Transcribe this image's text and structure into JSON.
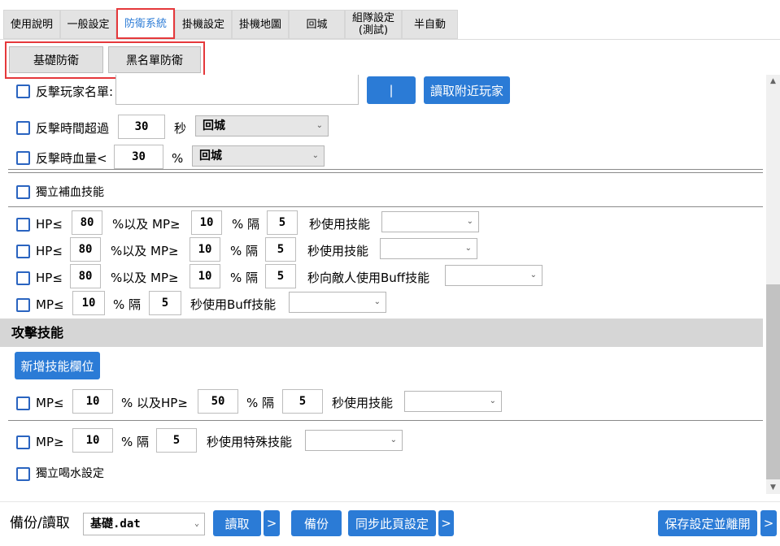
{
  "tabs": [
    {
      "label": "使用說明"
    },
    {
      "label": "一般設定"
    },
    {
      "label": "防衛系統"
    },
    {
      "label": "掛機設定"
    },
    {
      "label": "掛機地圖"
    },
    {
      "label": "回城"
    },
    {
      "label": "組隊設定\n(測試)"
    },
    {
      "label": "半自動"
    }
  ],
  "subtabs": [
    "基礎防衛",
    "黑名單防衛"
  ],
  "counter": {
    "list_label": "反擊玩家名單:",
    "pipe_button": "|",
    "read_nearby_button": "讀取附近玩家",
    "timeout_label": "反擊時間超過",
    "timeout_value": "30",
    "timeout_unit": "秒",
    "timeout_action": "回城",
    "hp_label": "反擊時血量<",
    "hp_value": "30",
    "hp_unit": "%",
    "hp_action": "回城"
  },
  "heal": {
    "independent_label": "獨立補血技能",
    "rows": [
      {
        "a": "HP≤",
        "v1": "80",
        "mid": "%以及 MP≥",
        "v2": "10",
        "gap": "% 隔",
        "v3": "5",
        "tail": "秒使用技能",
        "sel": ""
      },
      {
        "a": "HP≤",
        "v1": "80",
        "mid": "%以及 MP≥",
        "v2": "10",
        "gap": "% 隔",
        "v3": "5",
        "tail": "秒使用技能",
        "sel": ""
      },
      {
        "a": "HP≤",
        "v1": "80",
        "mid": "%以及 MP≥",
        "v2": "10",
        "gap": "% 隔",
        "v3": "5",
        "tail": "秒向敵人使用Buff技能",
        "sel": ""
      }
    ],
    "mp_row": {
      "a": "MP≤",
      "v1": "10",
      "gap": "% 隔",
      "v2": "5",
      "tail": "秒使用Buff技能",
      "sel": ""
    }
  },
  "attack": {
    "section_title": "攻擊技能",
    "add_button": "新增技能欄位",
    "row1": {
      "a": "MP≤",
      "v1": "10",
      "mid": "% 以及HP≥",
      "v2": "50",
      "gap": "% 隔",
      "v3": "5",
      "tail": "秒使用技能",
      "sel": ""
    },
    "row2": {
      "a": "MP≥",
      "v1": "10",
      "gap": "% 隔",
      "v2": "5",
      "tail": "秒使用特殊技能",
      "sel": ""
    },
    "drink_label": "獨立喝水設定"
  },
  "bottom": {
    "backup_label": "備份/讀取",
    "file_value": "基礎.dat",
    "read_button": "讀取",
    "arrow1": ">",
    "backup_button": "備份",
    "sync_button": "同步此頁設定",
    "arrow2": ">",
    "save_button": "保存設定並離開",
    "arrow3": ">"
  },
  "icons": {
    "dropdown": "chevron-down-icon",
    "scroll_up": "arrow-up-icon",
    "scroll_down": "arrow-down-icon"
  },
  "colors": {
    "accent": "#2b7bd6",
    "highlight": "#e5383b",
    "checkbox": "#2a64c0"
  }
}
